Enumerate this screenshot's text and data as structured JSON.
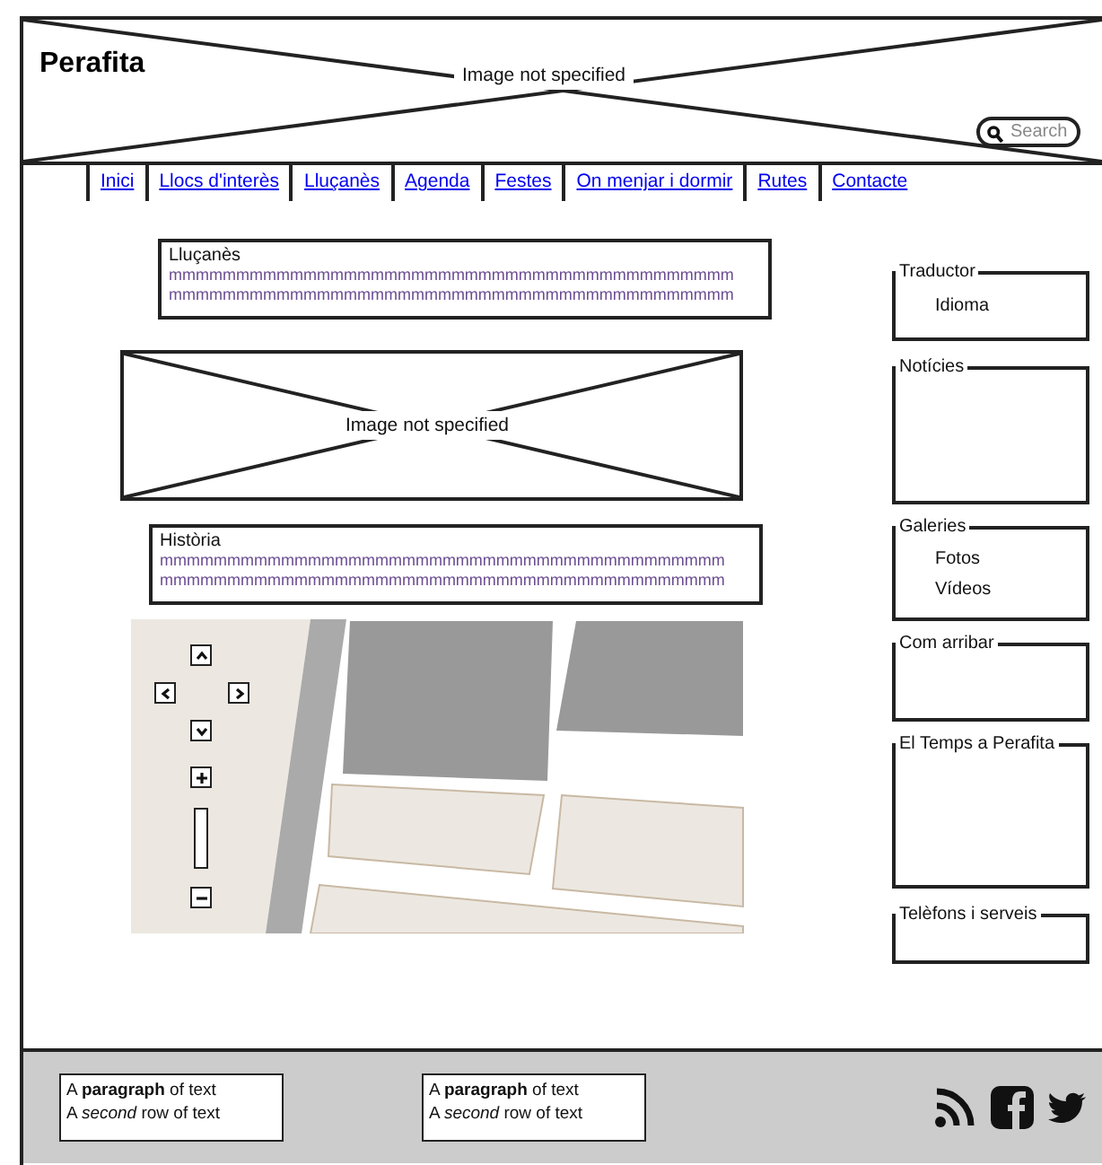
{
  "header": {
    "title": "Perafita",
    "image": {
      "caption": "Image not specified"
    },
    "search": {
      "placeholder": "Search"
    }
  },
  "nav": {
    "items": [
      {
        "label": "Inici"
      },
      {
        "label": "Llocs d'interès"
      },
      {
        "label": "Lluçanès"
      },
      {
        "label": "Agenda"
      },
      {
        "label": "Festes"
      },
      {
        "label": "On menjar i dormir"
      },
      {
        "label": "Rutes"
      },
      {
        "label": "Contacte"
      }
    ]
  },
  "main": {
    "sections": [
      {
        "kind": "text",
        "title": "Lluçanès",
        "lines": [
          "mmmmmmmmmmmmmmmmmmmmmmmmmmmmmmmmmmmmmmmmmm",
          "mmmmmmmmmmmmmmmmmmmmmmmmmmmmmmmmmmmmmmmmmm"
        ]
      },
      {
        "caption": "Image not specified"
      },
      {
        "kind": "text",
        "title": "Història",
        "lines": [
          "mmmmmmmmmmmmmmmmmmmmmmmmmmmmmmmmmmmmmmmmmm",
          "mmmmmmmmmmmmmmmmmmmmmmmmmmmmmmmmmmmmmmmmmm"
        ]
      },
      {
        "kind": "map"
      }
    ]
  },
  "sidebar": {
    "boxes": [
      {
        "title": "Traductor",
        "items": [
          "Idioma"
        ]
      },
      {
        "title": "Notícies"
      },
      {
        "title": "Galeries",
        "items": [
          "Fotos",
          "Vídeos"
        ]
      },
      {
        "title": "Com arribar"
      },
      {
        "title": "El Temps a Perafita"
      },
      {
        "title": "Telèfons i serveis"
      }
    ]
  },
  "footer": {
    "paragraphs": [
      {
        "lines": [
          "A **paragraph** of text",
          "A *second* row of text"
        ]
      },
      {
        "lines": [
          "A **paragraph** of text",
          "A *second* row of text"
        ]
      }
    ]
  }
}
